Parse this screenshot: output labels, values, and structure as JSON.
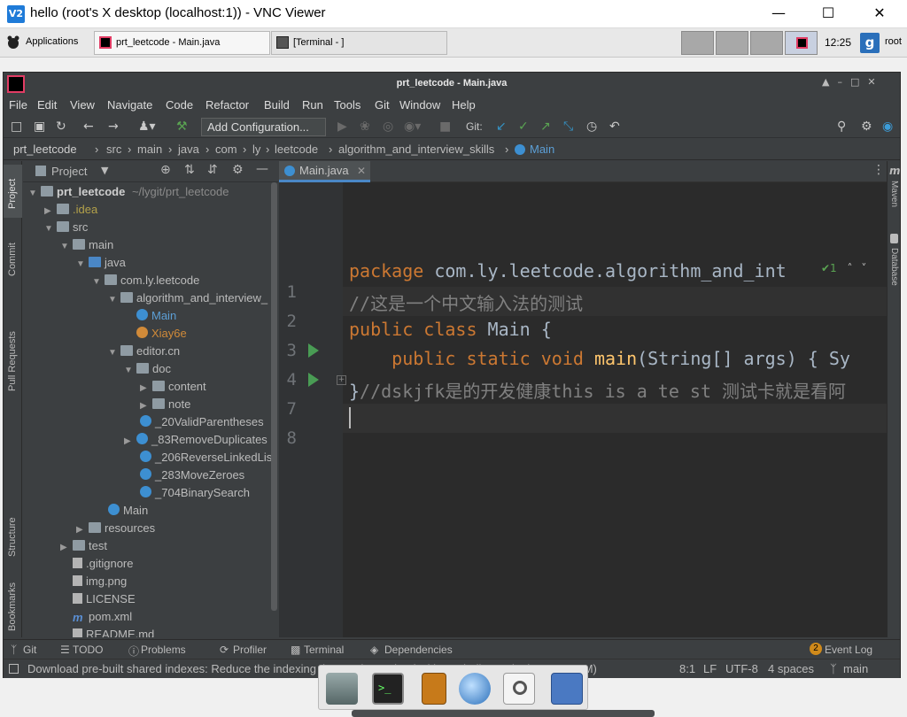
{
  "vnc": {
    "app_icon": "V2",
    "title": "hello (root's X desktop (localhost:1)) - VNC Viewer"
  },
  "panel": {
    "applications": "Applications",
    "tasks": [
      {
        "label": "prt_leetcode - Main.java",
        "icon": "intellij-icon"
      },
      {
        "label": "[Terminal - ]",
        "icon": "terminal-icon"
      }
    ],
    "clock": "12:25",
    "user": "root",
    "user_badge": "g"
  },
  "ide": {
    "title": "prt_leetcode - Main.java",
    "menu": [
      "File",
      "Edit",
      "View",
      "Navigate",
      "Code",
      "Refactor",
      "Build",
      "Run",
      "Tools",
      "Git",
      "Window",
      "Help"
    ],
    "add_configuration": "Add Configuration...",
    "git_label": "Git:",
    "breadcrumb": [
      "prt_leetcode",
      "src",
      "main",
      "java",
      "com",
      "ly",
      "leetcode",
      "algorithm_and_interview_skills",
      "Main"
    ],
    "project_label": "Project",
    "tree": [
      {
        "label": "prt_leetcode",
        "note": "~/lygit/prt_leetcode"
      },
      {
        "label": ".idea"
      },
      {
        "label": "src"
      },
      {
        "label": "main"
      },
      {
        "label": "java"
      },
      {
        "label": "com.ly.leetcode"
      },
      {
        "label": "algorithm_and_interview_"
      },
      {
        "label": "Main"
      },
      {
        "label": "Xiay6e"
      },
      {
        "label": "editor.cn"
      },
      {
        "label": "doc"
      },
      {
        "label": "content"
      },
      {
        "label": "note"
      },
      {
        "label": "_20ValidParentheses"
      },
      {
        "label": "_83RemoveDuplicates"
      },
      {
        "label": "_206ReverseLinkedLis"
      },
      {
        "label": "_283MoveZeroes"
      },
      {
        "label": "_704BinarySearch"
      },
      {
        "label": "Main"
      },
      {
        "label": "resources"
      },
      {
        "label": "test"
      },
      {
        "label": ".gitignore"
      },
      {
        "label": "img.png"
      },
      {
        "label": "LICENSE"
      },
      {
        "label": "pom.xml"
      },
      {
        "label": "README.md"
      }
    ],
    "tab": "Main.java",
    "lines": [
      {
        "num": "1",
        "parts": [
          {
            "t": "package ",
            "c": "kw"
          },
          {
            "t": "com.ly.leetcode.algorithm_and_int",
            "c": ""
          }
        ]
      },
      {
        "num": "2",
        "parts": [
          {
            "t": "//这是一个中文输入法的测试",
            "c": "cm"
          }
        ]
      },
      {
        "num": "3",
        "parts": [
          {
            "t": "public class ",
            "c": "kw"
          },
          {
            "t": "Main {",
            "c": ""
          }
        ]
      },
      {
        "num": "4",
        "parts": [
          {
            "t": "    public static void ",
            "c": "kw"
          },
          {
            "t": "main",
            "c": "fn"
          },
          {
            "t": "(String[] args) { Sy",
            "c": ""
          }
        ]
      },
      {
        "num": "7",
        "parts": [
          {
            "t": "}",
            "c": ""
          },
          {
            "t": "//dskjfk是的开发健康this is a te st 测试卡就是看阿",
            "c": "cm"
          }
        ]
      },
      {
        "num": "8",
        "parts": []
      }
    ],
    "inspection": "✔1",
    "left_strip": [
      "Project",
      "Commit",
      "Pull Requests",
      "Structure",
      "Bookmarks"
    ],
    "right_strip": [
      "Maven",
      "Database"
    ],
    "bottom_tools": [
      "Git",
      "TODO",
      "Problems",
      "Profiler",
      "Terminal",
      "Dependencies"
    ],
    "event_log": "Event Log",
    "event_count": "2",
    "status_message": "Download pre-built shared indexes: Reduce the indexing time and CPU load with pre-built M... (today 11:18 AM)",
    "status_right": [
      "8:1",
      "LF",
      "UTF-8",
      "4 spaces",
      "main"
    ]
  },
  "colors": {
    "editor_bg": "#2b2b2b",
    "keyword": "#cc7832",
    "comment": "#808080",
    "function": "#ffc66d",
    "text": "#a9b7c6",
    "run_green": "#499c54"
  }
}
